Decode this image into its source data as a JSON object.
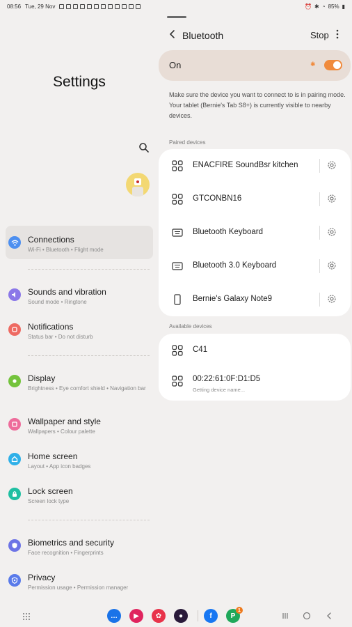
{
  "status_bar": {
    "time": "08:56",
    "date": "Tue, 29 Nov",
    "battery": "85%"
  },
  "left_pane": {
    "title": "Settings",
    "menu": [
      {
        "title": "Connections",
        "subtitle": "Wi-Fi • Bluetooth • Flight mode",
        "icon": "wifi-icon",
        "color": "#4d8ff0"
      },
      {
        "title": "Sounds and vibration",
        "subtitle": "Sound mode • Ringtone",
        "icon": "speaker-icon",
        "color": "#8b78e8"
      },
      {
        "title": "Notifications",
        "subtitle": "Status bar • Do not disturb",
        "icon": "bell-icon",
        "color": "#ee6a62"
      },
      {
        "title": "Display",
        "subtitle": "Brightness • Eye comfort shield • Navigation bar",
        "icon": "sun-icon",
        "color": "#74c33c"
      },
      {
        "title": "Wallpaper and style",
        "subtitle": "Wallpapers • Colour palette",
        "icon": "palette-icon",
        "color": "#ee6c9b"
      },
      {
        "title": "Home screen",
        "subtitle": "Layout • App icon badges",
        "icon": "home-icon",
        "color": "#2fb0e8"
      },
      {
        "title": "Lock screen",
        "subtitle": "Screen lock type",
        "icon": "lock-icon",
        "color": "#1fbfa2"
      },
      {
        "title": "Biometrics and security",
        "subtitle": "Face recognition • Fingerprints",
        "icon": "shield-icon",
        "color": "#6d74e6"
      },
      {
        "title": "Privacy",
        "subtitle": "Permission usage • Permission manager",
        "icon": "privacy-icon",
        "color": "#5a7bea"
      }
    ]
  },
  "right_pane": {
    "title": "Bluetooth",
    "stop_label": "Stop",
    "toggle_label": "On",
    "toggle_on": true,
    "description": "Make sure the device you want to connect to is in pairing mode. Your tablet (Bernie's Tab S8+) is currently visible to nearby devices.",
    "paired_label": "Paired devices",
    "paired": [
      {
        "name": "ENACFIRE SoundBsr  kitchen",
        "icon": "audio-device-icon"
      },
      {
        "name": "GTCONBN16",
        "icon": "audio-device-icon"
      },
      {
        "name": "Bluetooth Keyboard",
        "icon": "keyboard-icon"
      },
      {
        "name": "Bluetooth 3.0 Keyboard",
        "icon": "keyboard-icon"
      },
      {
        "name": "Bernie's Galaxy Note9",
        "icon": "phone-icon"
      }
    ],
    "available_label": "Available devices",
    "available": [
      {
        "name": "C41",
        "sub": "",
        "icon": "audio-device-icon"
      },
      {
        "name": "00:22:61:0F:D1:D5",
        "sub": "Getting device name...",
        "icon": "audio-device-icon"
      }
    ]
  },
  "colors": {
    "accent": "#f08a3c",
    "background": "#f2f0ef",
    "on_card": "#e8ddd6"
  }
}
